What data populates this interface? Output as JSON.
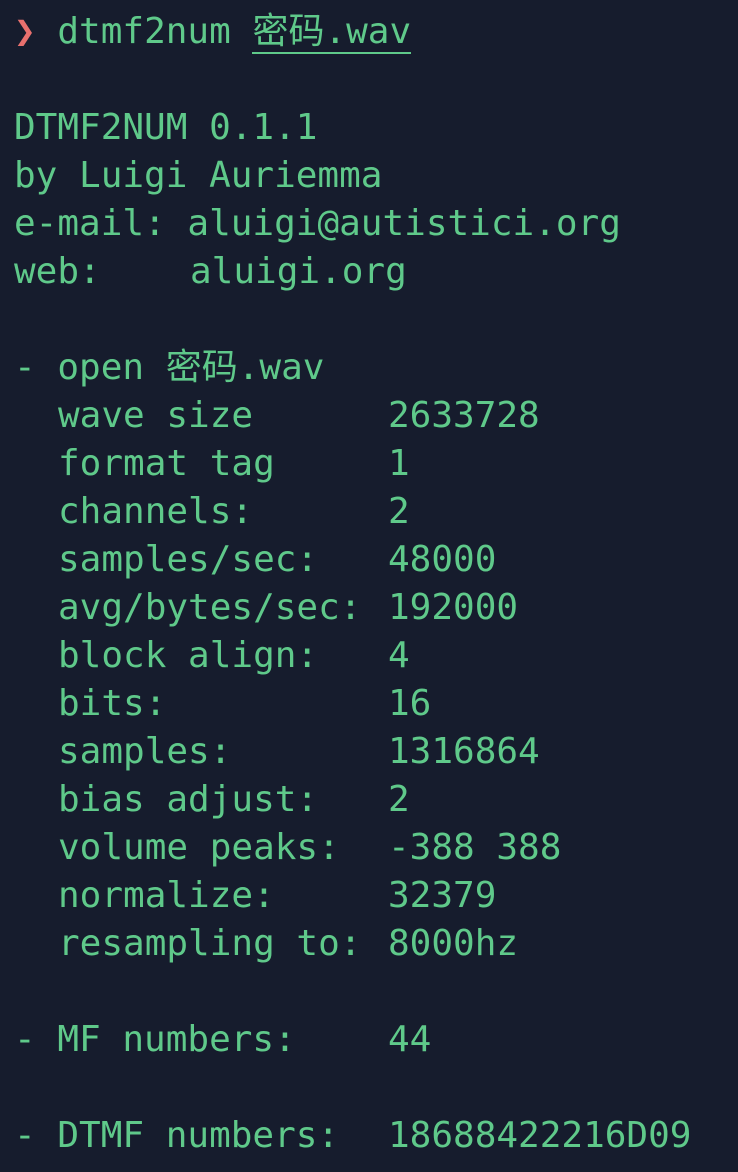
{
  "prompt": {
    "symbol": "❯",
    "command": "dtmf2num",
    "argument": "密码.wav"
  },
  "header": {
    "title": "DTMF2NUM 0.1.1",
    "author": "by Luigi Auriemma",
    "email_label": "e-mail:",
    "email": "aluigi@autistici.org",
    "web_label": "web:",
    "web": "aluigi.org"
  },
  "open": {
    "label": "- open 密码.wav",
    "fields": [
      {
        "key": "wave size",
        "value": "2633728"
      },
      {
        "key": "format tag",
        "value": "1"
      },
      {
        "key": "channels:",
        "value": "2"
      },
      {
        "key": "samples/sec:",
        "value": "48000"
      },
      {
        "key": "avg/bytes/sec:",
        "value": "192000"
      },
      {
        "key": "block align:",
        "value": "4"
      },
      {
        "key": "bits:",
        "value": "16"
      },
      {
        "key": "samples:",
        "value": "1316864"
      },
      {
        "key": "bias adjust:",
        "value": "2"
      },
      {
        "key": "volume peaks:",
        "value": "-388 388"
      },
      {
        "key": "normalize:",
        "value": "32379"
      },
      {
        "key": "resampling to:",
        "value": "8000hz"
      }
    ]
  },
  "results": {
    "mf_label": "- MF numbers:",
    "mf_value": "44",
    "dtmf_label": "- DTMF numbers:",
    "dtmf_value": "18688422216D09"
  },
  "colors": {
    "background": "#161c2d",
    "text": "#5fc98a",
    "prompt": "#e8706e"
  }
}
